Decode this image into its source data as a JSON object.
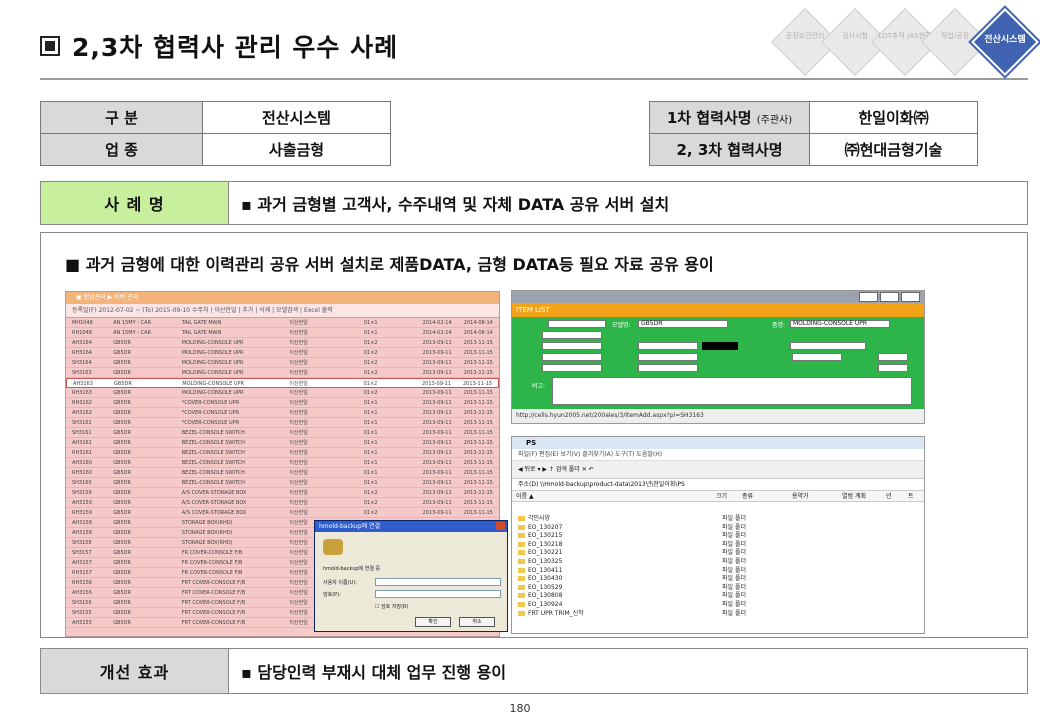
{
  "title": "2,3차 협력사 관리 우수 사례",
  "nav": [
    {
      "label": "공정조건관리"
    },
    {
      "label": "검사시험"
    },
    {
      "label": "LOT추적 /AS현황"
    },
    {
      "label": "작업/공정"
    },
    {
      "label": "전산시스템"
    }
  ],
  "info_left": {
    "r1_head": "구   분",
    "r1_val": "전산시스템",
    "r2_head": "업   종",
    "r2_val": "사출금형"
  },
  "info_right": {
    "r1_head": "1차 협력사명",
    "r1_head_small": "(주관사)",
    "r1_val": "한일이화㈜",
    "r2_head": "2, 3차 협력사명",
    "r2_val": "㈜현대금형기술"
  },
  "case": {
    "label": "사 례 명",
    "text": "▪ 과거 금형별 고객사, 수주내역 및 자체 DATA 공유 서버  설치"
  },
  "main": {
    "heading": "■ 과거 금형에 대한      이력관리 공유 서버 설치로 제품DATA, 금형 DATA등 필요 자료 공유  용이"
  },
  "shot_left": {
    "top": "▣ 현업관리 ▶ 이력 관리",
    "filter": "등록일(F) 2012-07-02 ~ (To) 2015-09-10  수주처 | 이산한일 | 추가 | 삭제 |     모델검색 | Excel 출력",
    "rows": [
      [
        "MH1048",
        "AN 15MY - CAR",
        "TAIL GATE MAIN",
        "이산한일",
        "01×1",
        "2014-02-14",
        "2014-08-14"
      ],
      [
        "RH1048",
        "AN 15MY - CAR",
        "TAIL GATE MAIN",
        "이산한일",
        "01×1",
        "2014-02-14",
        "2014-08-14"
      ],
      [
        "AH3164",
        "GB5DR",
        "MOLDING-CONSOLE UPR",
        "이산한일",
        "01×2",
        "2013-09-11",
        "2013-11-15"
      ],
      [
        "RH3164",
        "GB5DR",
        "MOLDING-CONSOLE UPR",
        "이산한일",
        "01×2",
        "2013-09-11",
        "2013-11-15"
      ],
      [
        "SH3164",
        "GB5DR",
        "MOLDING-CONSOLE UPR",
        "이산한일",
        "01×2",
        "2013-09-11",
        "2013-11-15"
      ],
      [
        "SH3163",
        "GB5DR",
        "MOLDING-CONSOLE UPR",
        "이산한일",
        "01×2",
        "2013-09-11",
        "2013-11-15"
      ],
      [
        "AH3163",
        "GB5DR",
        "MOLDING-CONSOLE UPR",
        "이산한일",
        "01×2",
        "2013-09-11",
        "2013-11-15"
      ],
      [
        "RH3163",
        "GB5DR",
        "MOLDING-CONSOLE UPR",
        "이산한일",
        "01×2",
        "2013-09-11",
        "2013-11-15"
      ],
      [
        "RH3162",
        "GB5DR",
        "*COVER-CONSOLE UPR",
        "이산한일",
        "01×1",
        "2013-09-11",
        "2013-11-15"
      ],
      [
        "AH3162",
        "GB5DR",
        "*COVER-CONSOLE UPR",
        "이산한일",
        "01×1",
        "2013-09-11",
        "2013-11-15"
      ],
      [
        "SH3162",
        "GB5DR",
        "*COVER-CONSOLE UPR",
        "이산한일",
        "01×1",
        "2013-09-11",
        "2013-11-15"
      ],
      [
        "SH3161",
        "GB5DR",
        "BEZEL-CONSOLE SWITCH",
        "이산한일",
        "01×1",
        "2013-09-11",
        "2013-11-15"
      ],
      [
        "AH3161",
        "GB5DR",
        "BEZEL-CONSOLE SWITCH",
        "이산한일",
        "01×1",
        "2013-09-11",
        "2013-11-15"
      ],
      [
        "RH3161",
        "GB5DR",
        "BEZEL-CONSOLE SWITCH",
        "이산한일",
        "01×1",
        "2013-09-11",
        "2013-11-15"
      ],
      [
        "AH3160",
        "GB5DR",
        "BEZEL-CONSOLE SWITCH",
        "이산한일",
        "01×1",
        "2013-09-11",
        "2013-11-15"
      ],
      [
        "RH3160",
        "GB5DR",
        "BEZEL-CONSOLE SWITCH",
        "이산한일",
        "01×1",
        "2013-09-11",
        "2013-11-15"
      ],
      [
        "SH3160",
        "GB5DR",
        "BEZEL-CONSOLE SWITCH",
        "이산한일",
        "01×1",
        "2013-09-11",
        "2013-11-15"
      ],
      [
        "SH3159",
        "GB5DR",
        "A/S COVER-STORAGE BOX",
        "이산한일",
        "01×2",
        "2013-09-11",
        "2013-11-15"
      ],
      [
        "AH3159",
        "GB5DR",
        "A/S COVER-STORAGE BOX",
        "이산한일",
        "01×2",
        "2013-09-11",
        "2013-11-15"
      ],
      [
        "RH3159",
        "GB5DR",
        "A/S COVER-STORAGE BOX",
        "이산한일",
        "01×2",
        "2013-09-11",
        "2013-11-15"
      ],
      [
        "AH3158",
        "GB5DR",
        "STORAGE BOX(RHD)",
        "이산한일",
        "01×1",
        "2013-09-11",
        "2013-11-15"
      ],
      [
        "AH3158",
        "GB5DR",
        "STORAGE BOX(RHD)",
        "이산한일",
        "01×1",
        "2013-09-11",
        "2013-11-15"
      ],
      [
        "SH3158",
        "GB5DR",
        "STORAGE BOX(RHD)",
        "이산한일",
        "01×1",
        "2013-09-11",
        "2013-11-15"
      ],
      [
        "SH3157",
        "GB5DR",
        "FR COVER-CONSOLE F/B",
        "이산한일",
        "01×2",
        "2013-09-11",
        "2013-11-15"
      ],
      [
        "AH3157",
        "GB5DR",
        "FR COVER-CONSOLE F/B",
        "이산한일",
        "01×2",
        "2013-09-11",
        "2013-11-15"
      ],
      [
        "RH3157",
        "GB5DR",
        "FR COVER-CONSOLE F/B",
        "이산한일",
        "01×2",
        "2013-09-11",
        "2013-11-15"
      ],
      [
        "RH3156",
        "GB5DR",
        "FRT COVER-CONSOLE F/B",
        "이산한일",
        "01×2",
        "2013-09-11",
        "2013-11-15"
      ],
      [
        "AH3156",
        "GB5DR",
        "FRT COVER-CONSOLE F/B",
        "이산한일",
        "01×2",
        "2013-09-11",
        "2013-11-15"
      ],
      [
        "SH3156",
        "GB5DR",
        "FRT COVER-CONSOLE F/B",
        "이산한일",
        "01×2",
        "2013-09-11",
        "2013-11-15"
      ],
      [
        "SH3155",
        "GB5DR",
        "FRT COVER-CONSOLE F/B",
        "이산한일",
        "01×2",
        "2013-09-11",
        "2013-11-15"
      ],
      [
        "AH3155",
        "GB5DR",
        "FRT COVER-CONSOLE F/B",
        "이산한일",
        "01×2",
        "2013-09-11",
        "2013-11-15"
      ]
    ]
  },
  "shot_rt": {
    "header": "ITEM LIST",
    "btns": [
      "신규",
      "저장",
      "닫기"
    ],
    "model_label": "모델명:",
    "model_val": "GB5DR",
    "item_label": "품명:",
    "item_val": "MOLDING-CONSOLE UPR",
    "memo_label": "비고:",
    "url": "http://cells.hyun2005.net/200ales/3/ItemAdd.aspx?pi=SH3163"
  },
  "shot_rb": {
    "title": "PS",
    "menu": "파일(F)  편집(E)  보기(V)  즐겨찾기(A)  도구(T)  도움말(H)",
    "tool": "◀ 뒤로 ▾   ▶   ↑   검색   폴더   ✕   ↶",
    "addr": "주소(D)  \\\\Hmold-backup\\product-data\\2013년\\한일이화\\PS",
    "cols": [
      "이름 ▲",
      "크기",
      "종류",
      "용약가",
      "열범 계획",
      "년",
      "트"
    ],
    "folders": [
      "각인사양",
      "EO_130207",
      "EO_130215",
      "EO_130218",
      "EO_130221",
      "EO_130325",
      "EO_130411",
      "EO_130430",
      "EO_130529",
      "EO_130808",
      "EO_130924",
      "FRT UPR TRIM_신작"
    ],
    "folder_type": "파일 폴더",
    "dialog_title": "hmold-backup에 연결",
    "dialog_connect": "hmold-backup에 연결 중",
    "dialog_user": "사용자 이름(U):",
    "dialog_pw": "암호(P):",
    "dialog_save": "암호 저장(R)",
    "dialog_ok": "확인",
    "dialog_cancel": "취소"
  },
  "effect": {
    "label": "개선 효과",
    "text": "▪ 담당인력 부재시 대체 업무 진행 용이"
  },
  "page_number": "180"
}
